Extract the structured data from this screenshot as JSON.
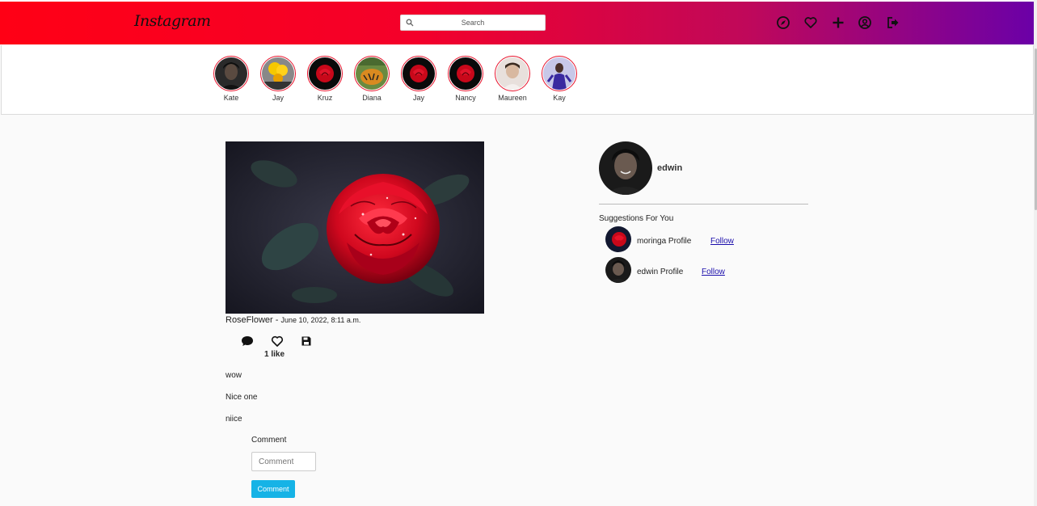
{
  "header": {
    "logo": "Instagram",
    "search_placeholder": "Search",
    "icons": [
      "compass-icon",
      "heart-icon",
      "plus-icon",
      "user-circle-icon",
      "sign-out-icon"
    ],
    "gradient": [
      "#ff0015",
      "#c0085a",
      "#6a00a8"
    ]
  },
  "stories": [
    {
      "name": "Kate",
      "thumb": "woman-portrait"
    },
    {
      "name": "Jay",
      "thumb": "yellow-balloons"
    },
    {
      "name": "Kruz",
      "thumb": "red-rose"
    },
    {
      "name": "Diana",
      "thumb": "tiger"
    },
    {
      "name": "Jay",
      "thumb": "red-rose"
    },
    {
      "name": "Nancy",
      "thumb": "red-rose"
    },
    {
      "name": "Maureen",
      "thumb": "girl-portrait"
    },
    {
      "name": "Kay",
      "thumb": "person-purple"
    }
  ],
  "post": {
    "image": "red-rose-photo",
    "title": "RoseFlower",
    "separator": " - ",
    "date": "June 10, 2022, 8:11 a.m.",
    "likes": "1 like",
    "comments": [
      "wow",
      "Nice one",
      "niice"
    ],
    "comment_label": "Comment",
    "comment_placeholder": "Comment",
    "comment_button": "Comment"
  },
  "sidebar": {
    "username": "edwin",
    "suggestions_title": "Suggestions For You",
    "suggestions": [
      {
        "name": "moringa Profile",
        "follow": "Follow",
        "avatar": "red-rose"
      },
      {
        "name": "edwin Profile",
        "follow": "Follow",
        "avatar": "woman-portrait"
      }
    ]
  },
  "colors": {
    "accent": "#e8132c",
    "button": "#16b3e6",
    "link": "#1a0dab"
  }
}
